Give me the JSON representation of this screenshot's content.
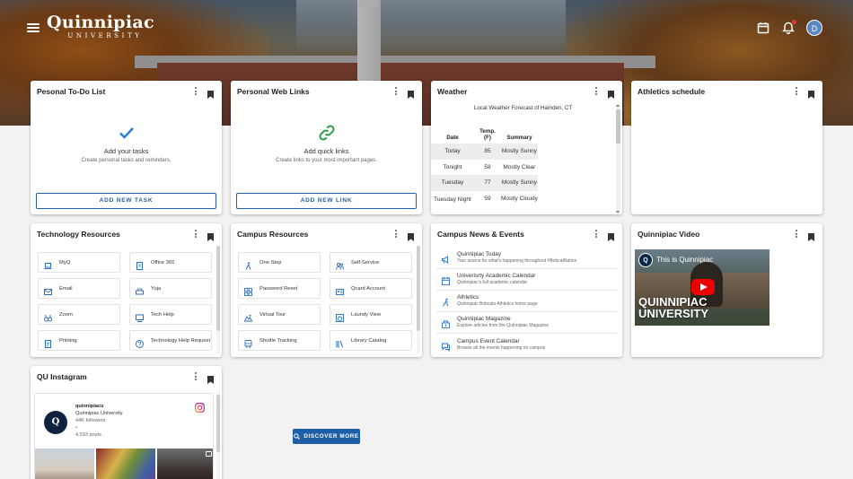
{
  "header": {
    "logo_name": "Quinnipiac",
    "logo_sub": "UNIVERSITY",
    "avatar_initial": "D",
    "icons": [
      "menu-icon",
      "calendar-icon",
      "bell-icon"
    ]
  },
  "todo": {
    "title": "Pesonal To-Do List",
    "empty_title": "Add your tasks",
    "empty_sub": "Create personal tasks and reminders.",
    "button": "ADD NEW TASK"
  },
  "links": {
    "title": "Personal Web Links",
    "empty_title": "Add quick links",
    "empty_sub": "Create links to your most important pages.",
    "button": "ADD NEW LINK"
  },
  "weather": {
    "title": "Weather",
    "caption": "Local Weather Forecast of Hamden, CT",
    "headers": [
      "Date",
      "Temp.\n(F)",
      "Summary"
    ],
    "rows": [
      {
        "date": "Today",
        "temp": "85",
        "summary": "Mostly Sunny"
      },
      {
        "date": "Tonight",
        "temp": "58",
        "summary": "Mostly Clear"
      },
      {
        "date": "Tuesday",
        "temp": "77",
        "summary": "Mostly Sunny"
      },
      {
        "date": "Tuesday Night",
        "temp": "59",
        "summary": "Mostly Cloudy"
      }
    ]
  },
  "athletics": {
    "title": "Athletics schedule"
  },
  "tech": {
    "title": "Technology Resources",
    "items": [
      {
        "label": "MyQ",
        "icon": "laptop-icon"
      },
      {
        "label": "Office 365",
        "icon": "office-icon"
      },
      {
        "label": "Email",
        "icon": "email-icon"
      },
      {
        "label": "Yuja",
        "icon": "printer-icon"
      },
      {
        "label": "Zoom",
        "icon": "binoculars-icon"
      },
      {
        "label": "Tech Help",
        "icon": "help-desk-icon"
      },
      {
        "label": "Printing",
        "icon": "document-icon"
      },
      {
        "label": "Technology Help Request",
        "icon": "question-icon"
      }
    ]
  },
  "campus": {
    "title": "Campus Resources",
    "items": [
      {
        "label": "One Stop",
        "icon": "walk-icon"
      },
      {
        "label": "Self-Service",
        "icon": "group-icon"
      },
      {
        "label": "Password Reset",
        "icon": "key-grid-icon"
      },
      {
        "label": "Qcard Account",
        "icon": "id-card-icon"
      },
      {
        "label": "Virtual Tour",
        "icon": "tour-icon"
      },
      {
        "label": "Laundy View",
        "icon": "laundry-icon"
      },
      {
        "label": "Shuttle Tracking",
        "icon": "bus-icon"
      },
      {
        "label": "Library Catalog",
        "icon": "library-icon"
      }
    ]
  },
  "news": {
    "title": "Campus News & Events",
    "items": [
      {
        "title": "Quinnipiac Today",
        "sub": "Your source for what's happening throughout #BobcatNation",
        "icon": "megaphone-icon"
      },
      {
        "title": "Univerisrty Academic Calendar",
        "sub": "Quinnipiac's full academic calendar",
        "icon": "calendar-icon"
      },
      {
        "title": "Athletics",
        "sub": "Quinnipiac Bobcats Athletics home page",
        "icon": "runner-icon"
      },
      {
        "title": "Quinnipiac Magazine",
        "sub": "Explore articles from the Quinnipiac Magazine",
        "icon": "magazine-icon"
      },
      {
        "title": "Campus Event Calendar",
        "sub": "Browse all the events happening on campus",
        "icon": "event-chat-icon"
      }
    ]
  },
  "video": {
    "title": "Quinnipiac Video",
    "video_title": "This is Quinnipiac",
    "video_overlay": "QUINNIPIAC\nUNIVERSITY",
    "channel_initial": "Q"
  },
  "instagram": {
    "title": "QU Instagram",
    "username": "quinnipiacu",
    "display_name": "Quinnipiac University",
    "followers": "44K followers",
    "separator": "•",
    "posts": "4,593 posts",
    "avatar_initial": "Q"
  },
  "discover": {
    "label": "DISCOVER MORE"
  },
  "colors": {
    "accent": "#1f5fa8",
    "check": "#2a7de1",
    "link_icon": "#2e9e4a",
    "notification": "#e53935"
  }
}
